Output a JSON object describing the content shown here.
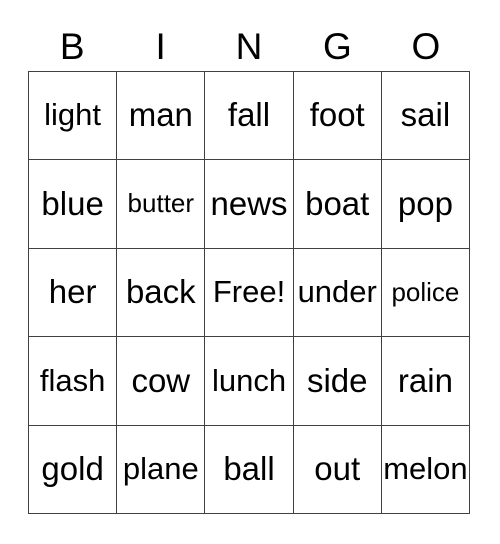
{
  "card": {
    "title": "BINGO",
    "columns": [
      "B",
      "I",
      "N",
      "G",
      "O"
    ],
    "free_space_label": "Free!",
    "free_space_position": {
      "row": 2,
      "col": 2
    },
    "colors": {
      "background": "#ffffff",
      "cell_background": "#ffffff",
      "border": "#404040",
      "text": "#000000"
    },
    "grid": [
      [
        "light",
        "man",
        "fall",
        "foot",
        "sail"
      ],
      [
        "blue",
        "butter",
        "news",
        "boat",
        "pop"
      ],
      [
        "her",
        "back",
        "Free!",
        "under",
        "police"
      ],
      [
        "flash",
        "cow",
        "lunch",
        "side",
        "rain"
      ],
      [
        "gold",
        "plane",
        "ball",
        "out",
        "melon"
      ]
    ]
  }
}
